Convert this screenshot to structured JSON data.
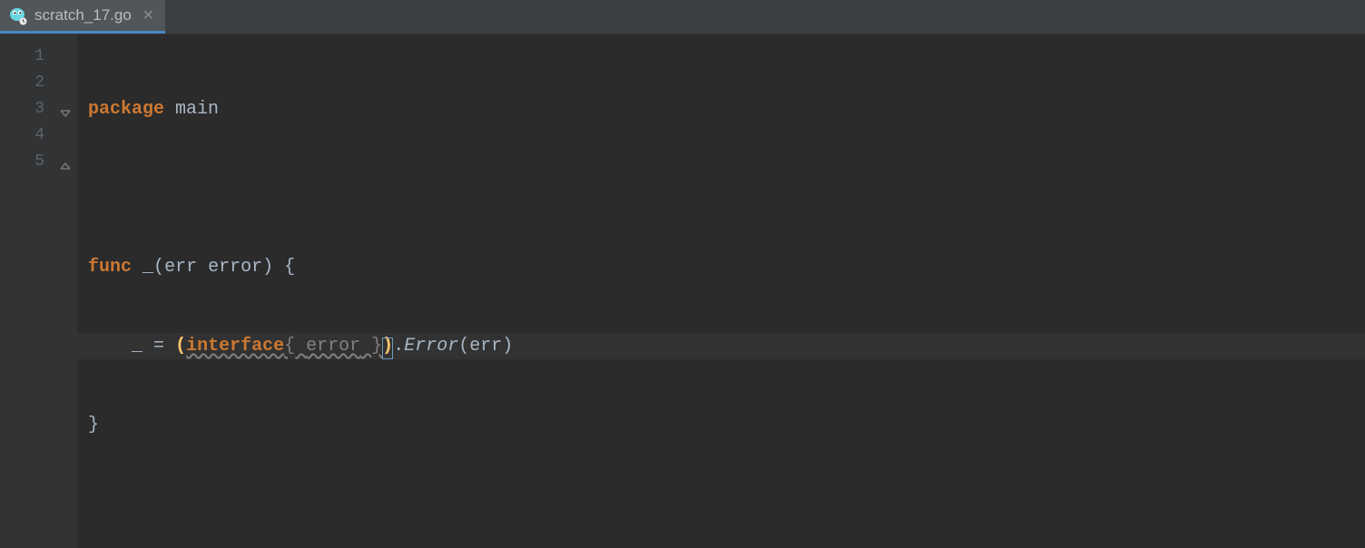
{
  "tab": {
    "label": "scratch_17.go"
  },
  "gutter": {
    "lines": [
      "1",
      "2",
      "3",
      "4",
      "5"
    ]
  },
  "code": {
    "l1kw": "package",
    "l1id": "main",
    "l3kw": "func",
    "l3under": "_",
    "l3p1": "(",
    "l3param": "err",
    "l3type": "error",
    "l3p2": ")",
    "l3brace": "{",
    "l4und": "_",
    "l4eq": "=",
    "l4op": "(",
    "l4iface": "interface",
    "l4ob": "{ ",
    "l4err": "error",
    "l4cb": " }",
    "l4cp": ")",
    "l4dot": ".",
    "l4meth": "Error",
    "l4p1": "(",
    "l4arg": "err",
    "l4p2": ")",
    "l5brace": "}"
  }
}
